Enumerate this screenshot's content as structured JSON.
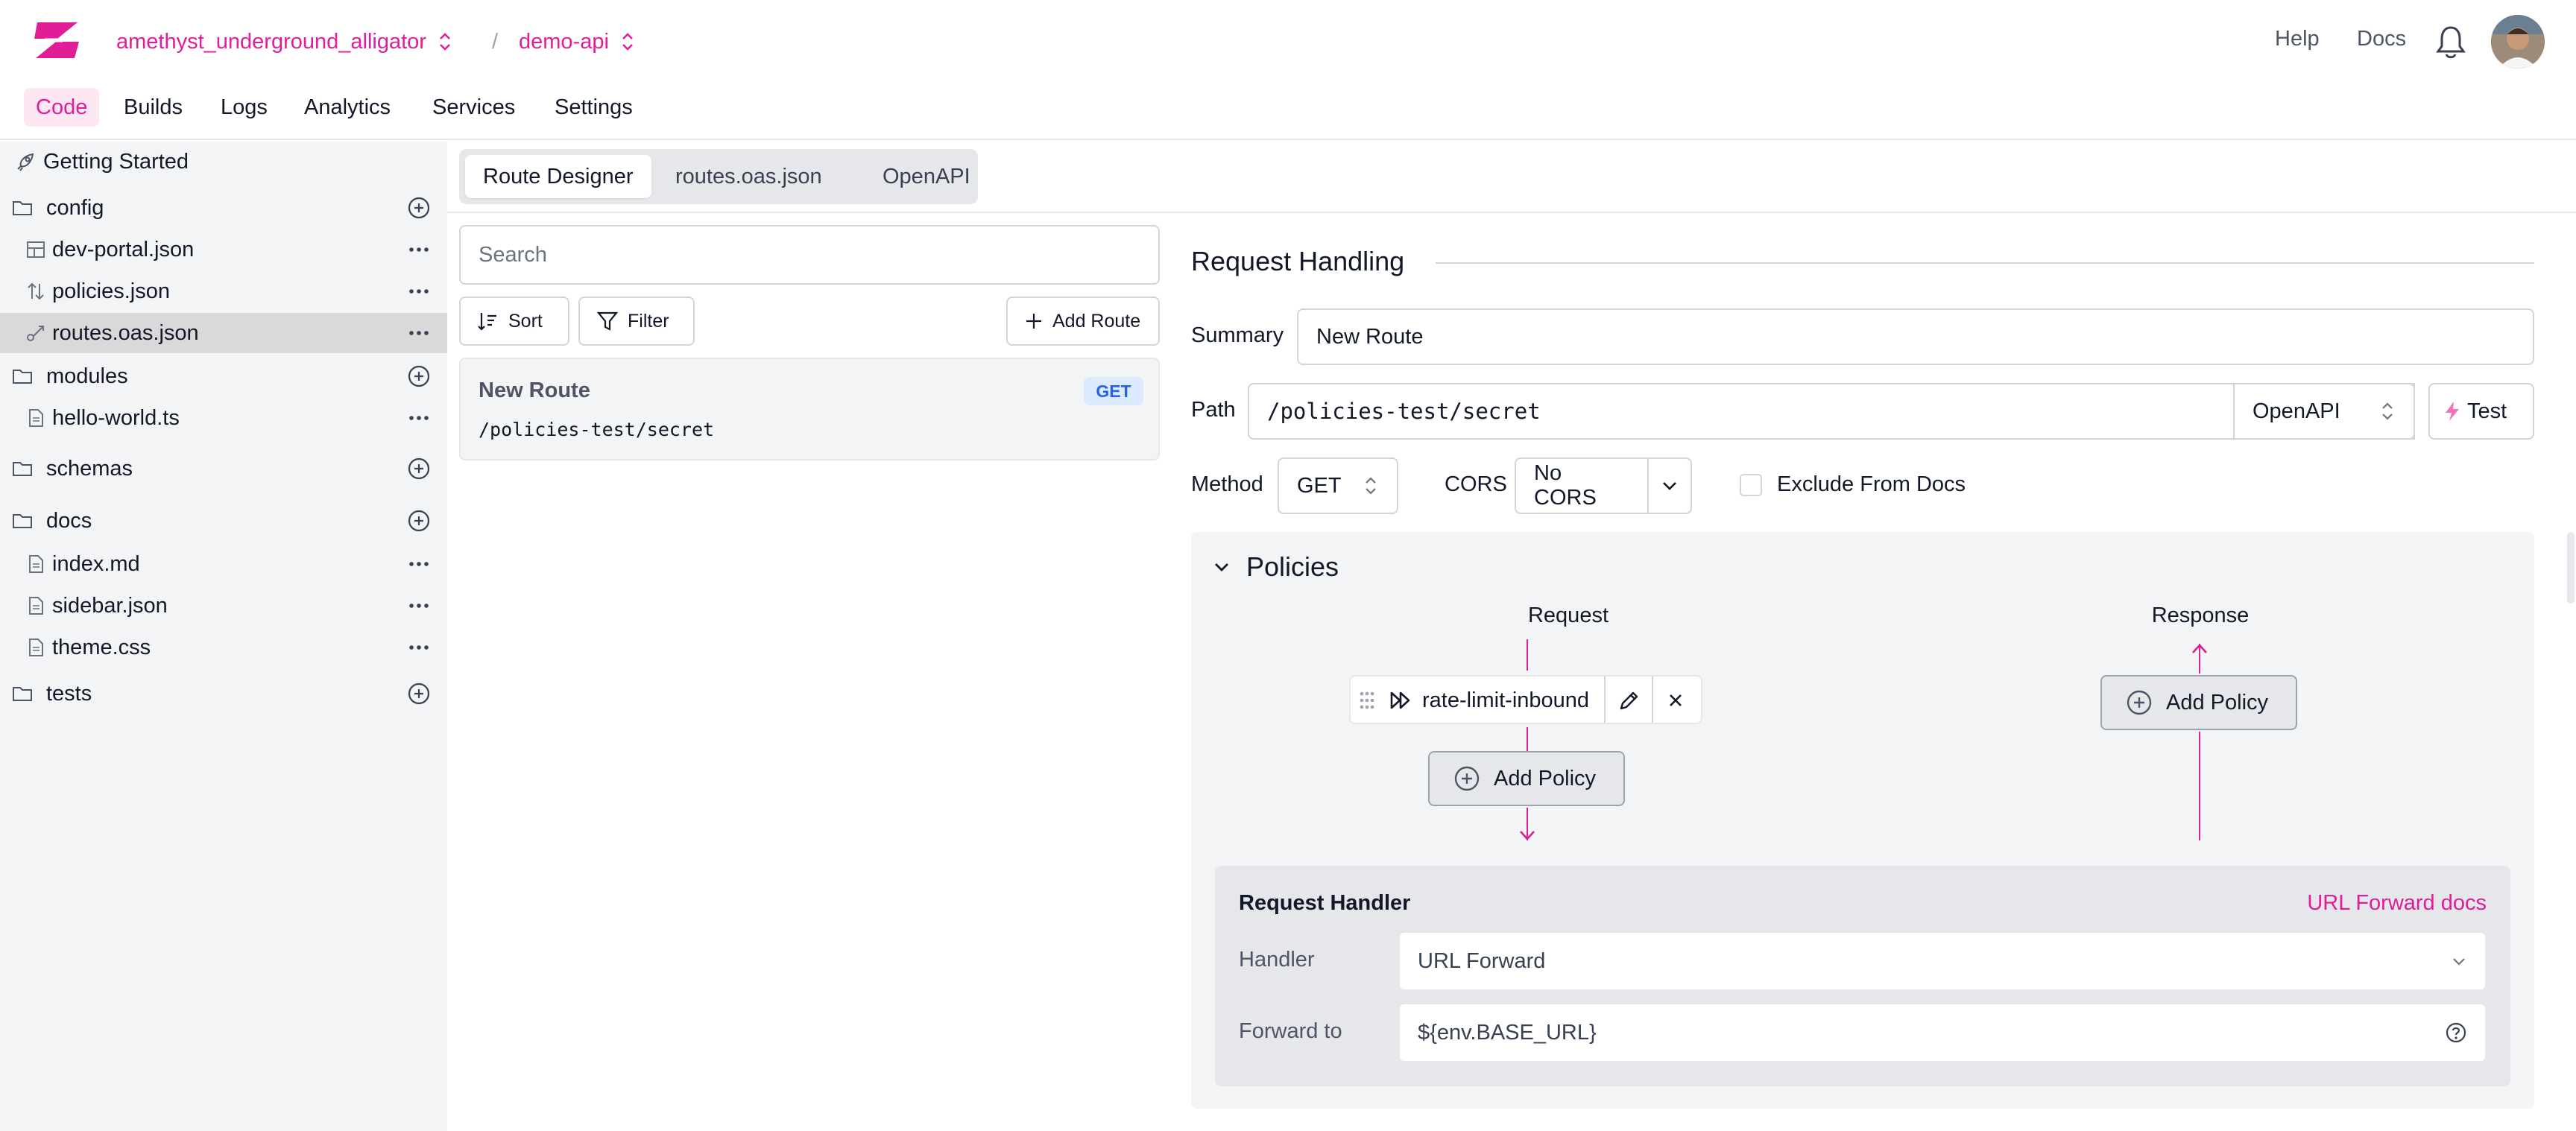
{
  "header": {
    "project": "amethyst_underground_alligator",
    "separator": "/",
    "repo": "demo-api",
    "help": "Help",
    "docs": "Docs"
  },
  "nav": [
    "Code",
    "Builds",
    "Logs",
    "Analytics",
    "Services",
    "Settings"
  ],
  "sidebar": {
    "getting_started": "Getting Started",
    "items": [
      {
        "label": "config",
        "kind": "folder"
      },
      {
        "label": "dev-portal.json",
        "kind": "file",
        "icon": "layout-icon"
      },
      {
        "label": "policies.json",
        "kind": "file",
        "icon": "arrows-up-down-icon"
      },
      {
        "label": "routes.oas.json",
        "kind": "file",
        "icon": "route-icon",
        "selected": true
      },
      {
        "label": "modules",
        "kind": "folder"
      },
      {
        "label": "hello-world.ts",
        "kind": "file",
        "icon": "file-icon"
      },
      {
        "label": "schemas",
        "kind": "folder"
      },
      {
        "label": "docs",
        "kind": "folder"
      },
      {
        "label": "index.md",
        "kind": "file",
        "icon": "file-icon"
      },
      {
        "label": "sidebar.json",
        "kind": "file",
        "icon": "file-icon"
      },
      {
        "label": "theme.css",
        "kind": "file",
        "icon": "file-icon"
      },
      {
        "label": "tests",
        "kind": "folder"
      }
    ]
  },
  "tabs": [
    "Route Designer",
    "routes.oas.json",
    "OpenAPI"
  ],
  "routes": {
    "search_placeholder": "Search",
    "sort": "Sort",
    "filter": "Filter",
    "add_route": "Add Route",
    "list": [
      {
        "name": "New Route",
        "method": "GET",
        "path": "/policies-test/secret"
      }
    ]
  },
  "request_handling": {
    "title": "Request Handling",
    "summary_label": "Summary",
    "summary_value": "New Route",
    "path_label": "Path",
    "path_value": "/policies-test/secret",
    "path_format": "OpenAPI",
    "test_button": "Test",
    "method_label": "Method",
    "method_value": "GET",
    "cors_label": "CORS",
    "cors_value": "No CORS",
    "exclude_label": "Exclude From Docs"
  },
  "policies": {
    "title": "Policies",
    "request_label": "Request",
    "response_label": "Response",
    "inbound_policy": "rate-limit-inbound",
    "add_policy": "Add Policy"
  },
  "request_handler": {
    "title": "Request Handler",
    "docs_link": "URL Forward docs",
    "handler_label": "Handler",
    "handler_value": "URL Forward",
    "forward_label": "Forward to",
    "forward_value": "${env.BASE_URL}"
  },
  "colors": {
    "accent": "#e11d98",
    "get_badge_bg": "#dbeafe",
    "get_badge_text": "#2563eb"
  }
}
